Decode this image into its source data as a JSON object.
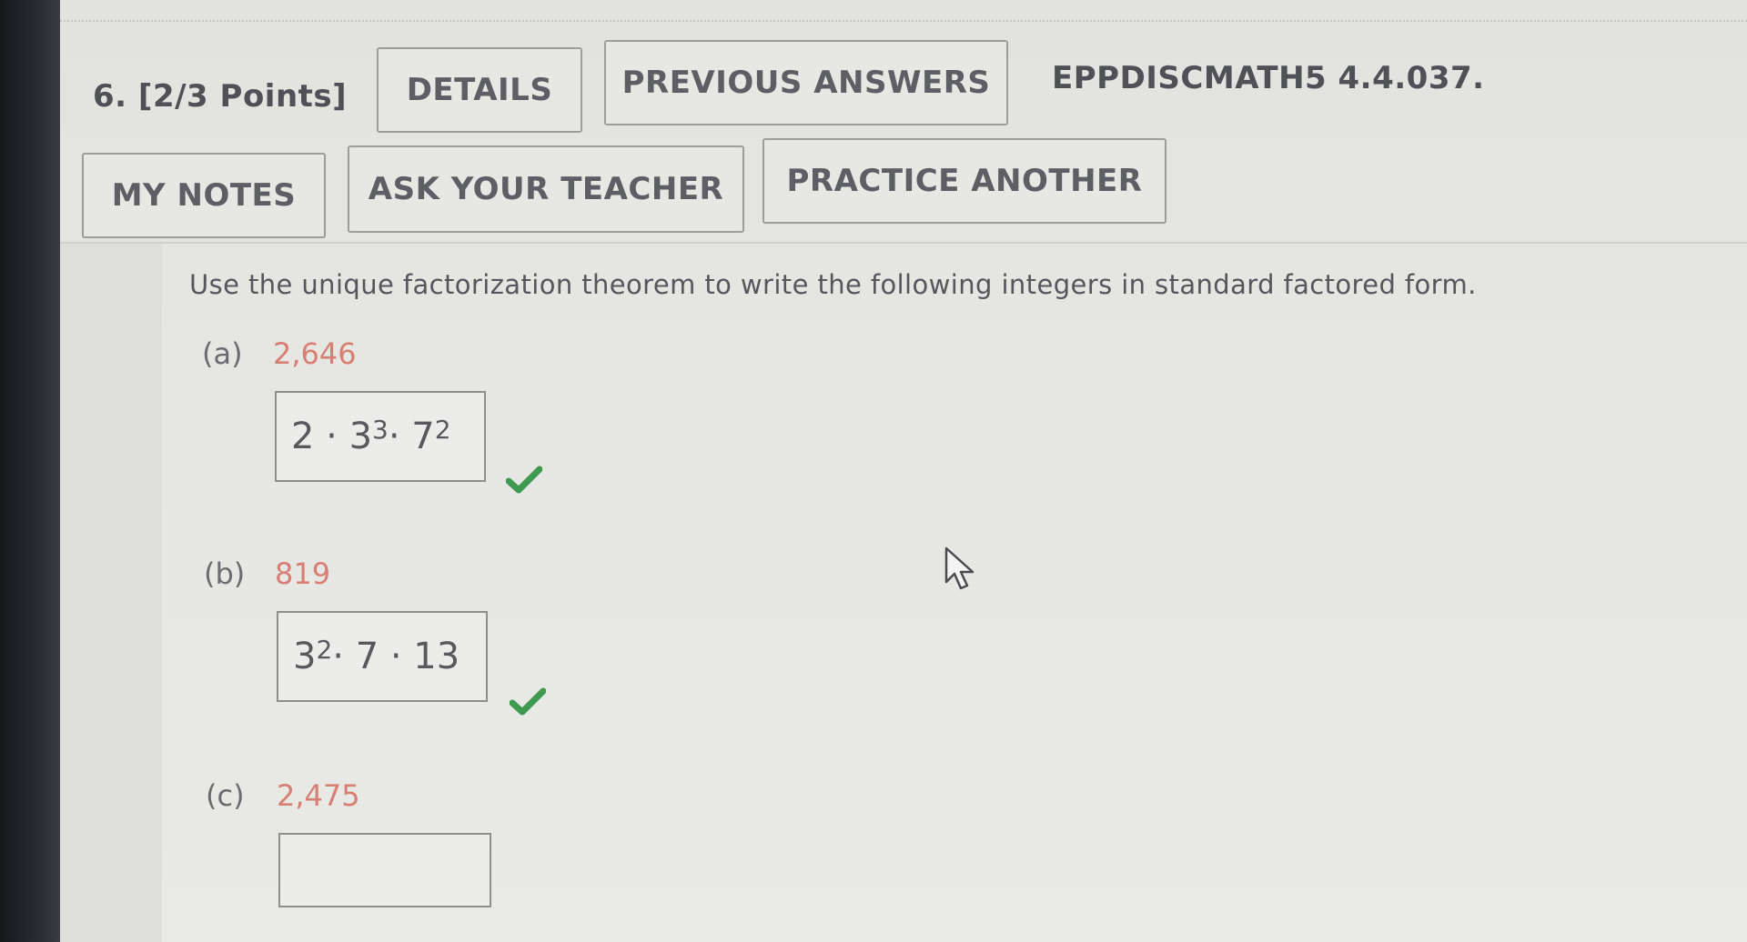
{
  "question": {
    "header": "6. [2/3 Points]",
    "assignment_code": "EPPDISCMATH5 4.4.037."
  },
  "buttons": {
    "details": "DETAILS",
    "previous_answers": "PREVIOUS ANSWERS",
    "my_notes": "MY NOTES",
    "ask_your_teacher": "ASK YOUR TEACHER",
    "practice_another": "PRACTICE ANOTHER"
  },
  "prompt": "Use the unique factorization theorem to write the following integers in standard factored form.",
  "parts": [
    {
      "label": "(a)",
      "number": "2,646",
      "answer": {
        "base1": "2 · 3",
        "exp1": "3",
        "mid": " · 7",
        "exp2": "2",
        "tail": ""
      },
      "status": "correct"
    },
    {
      "label": "(b)",
      "number": "819",
      "answer": {
        "base1": "3",
        "exp1": "2",
        "mid": " · 7 · 13",
        "exp2": "",
        "tail": ""
      },
      "status": "correct"
    },
    {
      "label": "(c)",
      "number": "2,475",
      "answer_value": "",
      "status": "unanswered"
    }
  ],
  "icons": {
    "check": "check-icon",
    "cursor": "mouse-pointer-icon"
  },
  "colors": {
    "correct_check": "#3e9a4e",
    "number_highlight": "#d77f72"
  }
}
